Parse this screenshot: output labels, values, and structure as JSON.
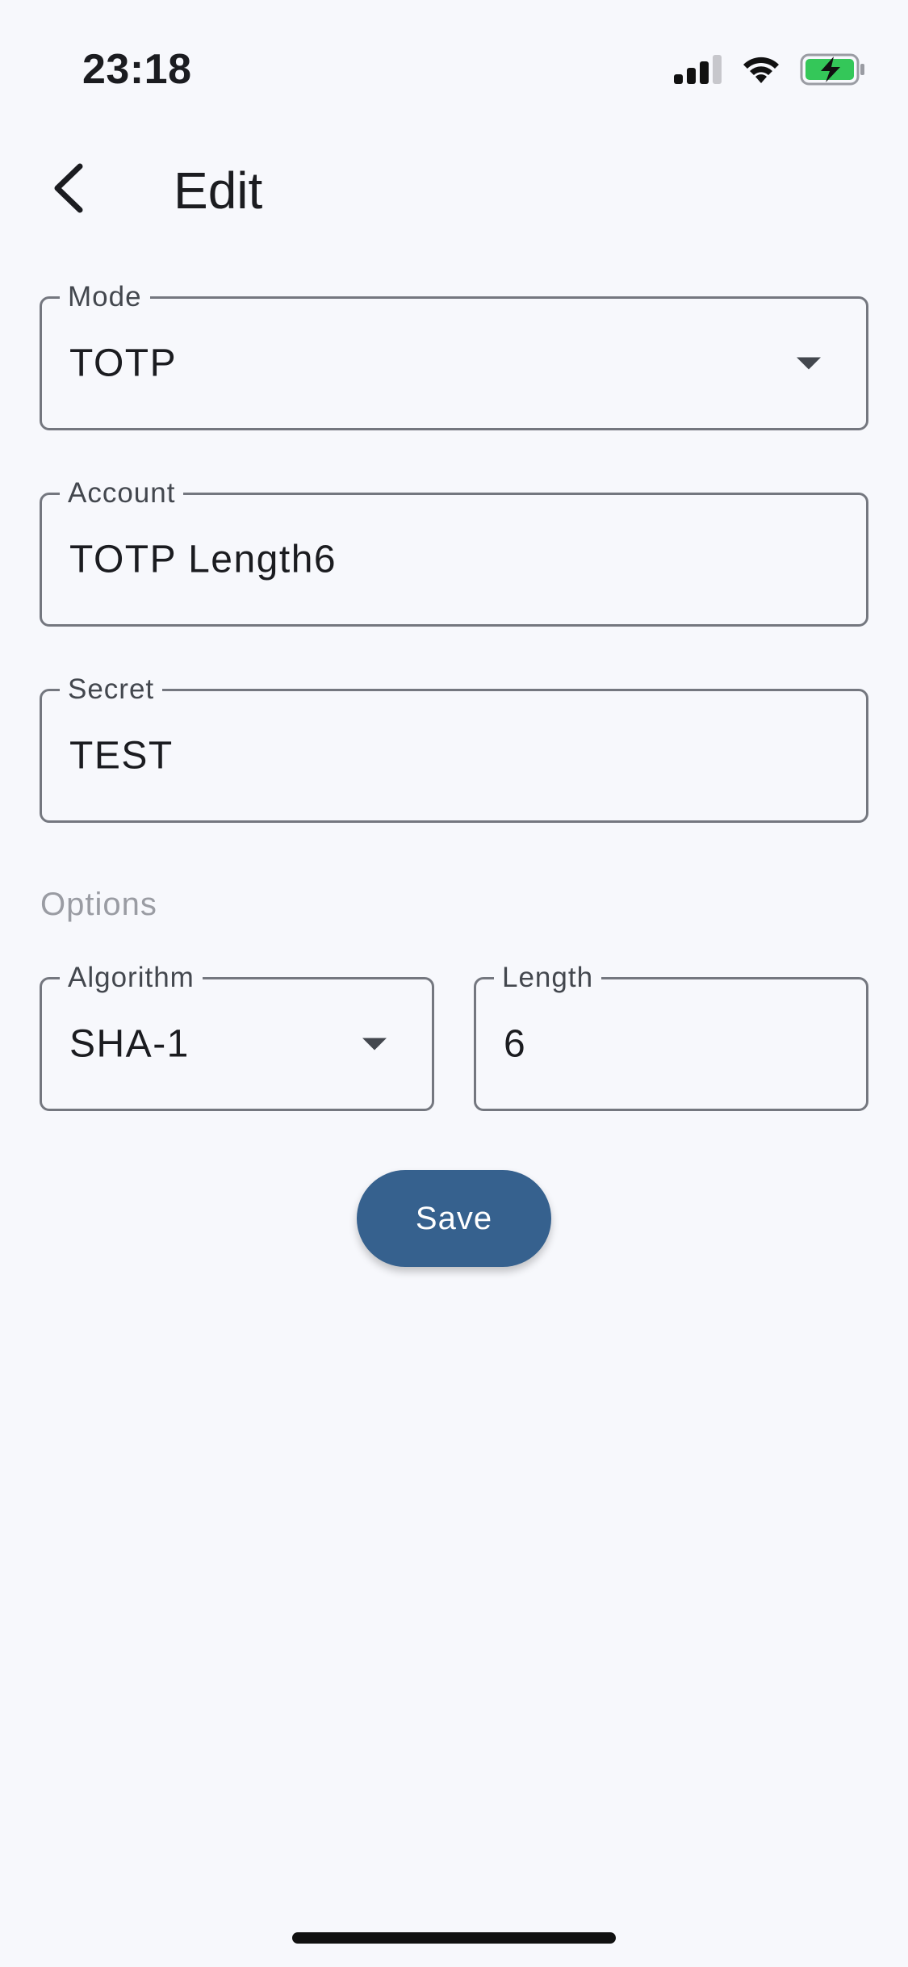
{
  "status_bar": {
    "time": "23:18",
    "icons": [
      "cellular-signal-icon",
      "wifi-icon",
      "battery-charging-icon"
    ],
    "battery_color": "#34c759"
  },
  "app_bar": {
    "back_icon": "chevron-left-icon",
    "title": "Edit"
  },
  "form": {
    "mode": {
      "label": "Mode",
      "value": "TOTP",
      "icon": "dropdown-arrow-icon"
    },
    "account": {
      "label": "Account",
      "value": "TOTP Length6"
    },
    "secret": {
      "label": "Secret",
      "value": "TEST"
    },
    "options_label": "Options",
    "algorithm": {
      "label": "Algorithm",
      "value": "SHA-1",
      "icon": "dropdown-arrow-icon"
    },
    "length": {
      "label": "Length",
      "value": "6"
    },
    "save_label": "Save"
  },
  "colors": {
    "background": "#f7f8fc",
    "primary": "#36618e",
    "outline": "#74777f"
  }
}
